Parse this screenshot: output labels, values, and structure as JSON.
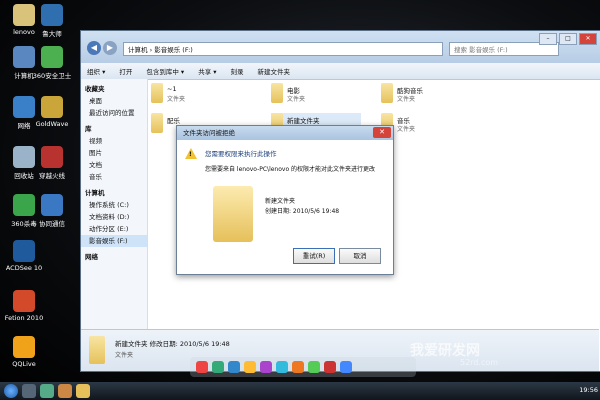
{
  "desktop": {
    "icons": [
      {
        "label": "lenovo"
      },
      {
        "label": "鲁大师"
      },
      {
        "label": "计算机"
      },
      {
        "label": "360安全卫士"
      },
      {
        "label": "网络"
      },
      {
        "label": "GoldWave"
      },
      {
        "label": "回收站"
      },
      {
        "label": "穿越火线"
      },
      {
        "label": "360杀毒"
      },
      {
        "label": "协同通信"
      },
      {
        "label": "ACDSee 10"
      },
      {
        "label": "Fetion 2010"
      },
      {
        "label": "QQLive"
      }
    ]
  },
  "explorer": {
    "address": "计算机 › 影音娱乐 (F:)",
    "search_placeholder": "搜索 影音娱乐 (F:)",
    "toolbar": [
      "组织 ▾",
      "打开",
      "包含到库中 ▾",
      "共享 ▾",
      "刻录",
      "新建文件夹"
    ],
    "sidebar": [
      {
        "label": "收藏夹",
        "group": true
      },
      {
        "label": "桌面"
      },
      {
        "label": "最近访问的位置"
      },
      {
        "label": "库",
        "group": true
      },
      {
        "label": "视频"
      },
      {
        "label": "图片"
      },
      {
        "label": "文档"
      },
      {
        "label": "音乐"
      },
      {
        "label": "计算机",
        "group": true
      },
      {
        "label": "操作系统 (C:)"
      },
      {
        "label": "文档资料 (D:)"
      },
      {
        "label": "动作分区 (E:)"
      },
      {
        "label": "影音娱乐 (F:)"
      },
      {
        "label": "网络",
        "group": true
      }
    ],
    "items": [
      {
        "name": "~1",
        "type": "文件夹"
      },
      {
        "name": "电影",
        "type": "文件夹"
      },
      {
        "name": "酷狗音乐",
        "type": "文件夹"
      },
      {
        "name": "配乐",
        "type": ""
      },
      {
        "name": "新建文件夹",
        "type": ""
      },
      {
        "name": "音乐",
        "type": "文件夹"
      }
    ],
    "details": {
      "name": "新建文件夹  修改日期: 2010/5/6 19:48",
      "type": "文件夹"
    }
  },
  "dialog": {
    "title": "文件夹访问被拒绝",
    "heading": "您需要权限来执行此操作",
    "message": "您需要来自 lenovo-PC\\lenovo 的权限才能对此文件夹进行更改",
    "folder_name": "新建文件夹",
    "folder_date": "创建日期: 2010/5/6 19:48",
    "retry": "重试(R)",
    "cancel": "取消"
  },
  "taskbar": {
    "clock": "19:56"
  },
  "watermark": {
    "main": "我爱研发网",
    "sub": "52rd.com"
  }
}
